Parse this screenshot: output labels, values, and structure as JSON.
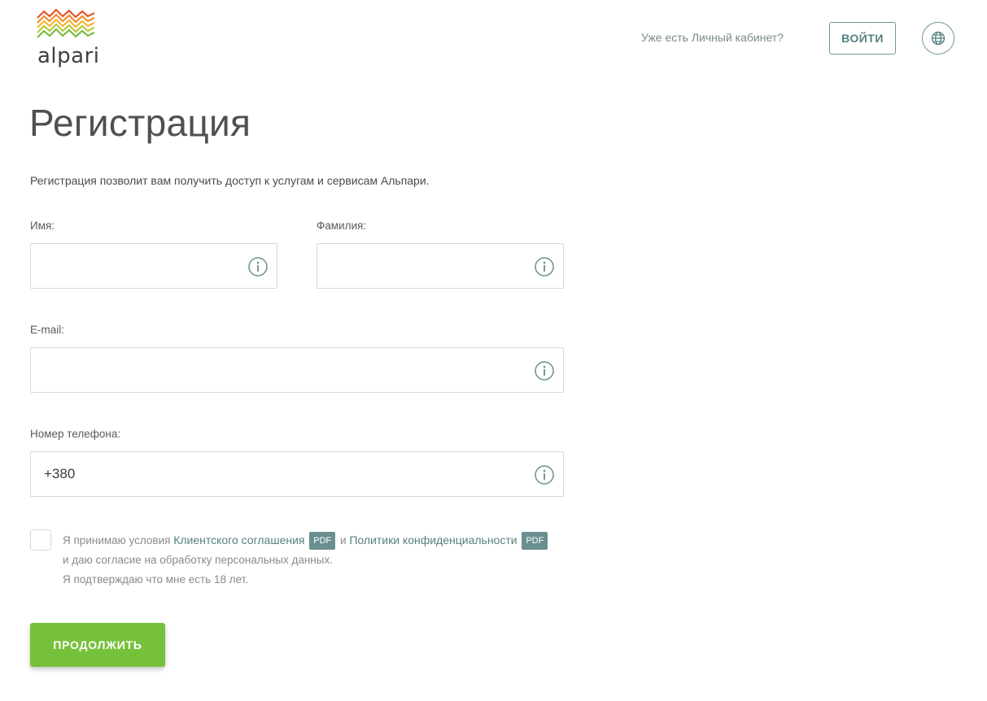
{
  "header": {
    "logo_text": "alpari",
    "already_have_account": "Уже есть Личный кабинет?",
    "login_label": "ВОЙТИ",
    "language_icon": "globe-icon"
  },
  "page": {
    "title": "Регистрация",
    "subtitle": "Регистрация позволит вам получить доступ к услугам и сервисам Альпари."
  },
  "form": {
    "first_name": {
      "label": "Имя:",
      "value": ""
    },
    "last_name": {
      "label": "Фамилия:",
      "value": ""
    },
    "email": {
      "label": "E-mail:",
      "value": ""
    },
    "phone": {
      "label": "Номер телефона:",
      "value": "+380"
    },
    "info_icon": "info-circle-icon"
  },
  "agreement": {
    "prefix": "Я принимаю условия ",
    "client_agreement_link": "Клиентского соглашения",
    "pdf_badge": "PDF",
    "conjunction": " и ",
    "privacy_policy_link": "Политики конфиденциальности",
    "line2": "и даю согласие на обработку персональных данных.",
    "line3": "Я подтверждаю что мне есть 18 лет.",
    "checked": false
  },
  "actions": {
    "continue_label": "ПРОДОЛЖИТЬ"
  },
  "colors": {
    "accent_green": "#76c13b",
    "teal": "#557f80",
    "pdf_badge": "#6a8f90",
    "border": "#d3d8d8"
  }
}
